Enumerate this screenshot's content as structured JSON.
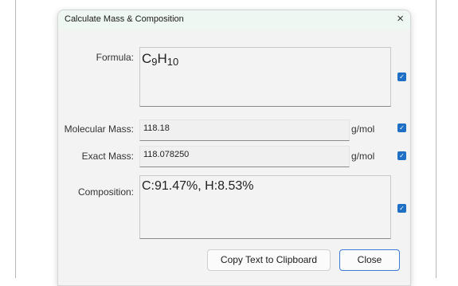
{
  "window": {
    "title": "Calculate Mass & Composition",
    "close_glyph": "×"
  },
  "formula": {
    "label": "Formula:",
    "parts": [
      {
        "element": "C",
        "count": "9"
      },
      {
        "element": "H",
        "count": "10"
      }
    ],
    "checked": true
  },
  "molecular_mass": {
    "label": "Molecular Mass:",
    "value": "118.18",
    "unit": "g/mol",
    "checked": true
  },
  "exact_mass": {
    "label": "Exact Mass:",
    "value": "118.078250",
    "unit": "g/mol",
    "checked": true
  },
  "composition": {
    "label": "Composition:",
    "value": "C:91.47%, H:8.53%",
    "checked": true
  },
  "buttons": {
    "copy": "Copy Text to Clipboard",
    "close": "Close"
  },
  "colors": {
    "accent": "#1f6fc5",
    "titlebar": "#eef7f2"
  }
}
